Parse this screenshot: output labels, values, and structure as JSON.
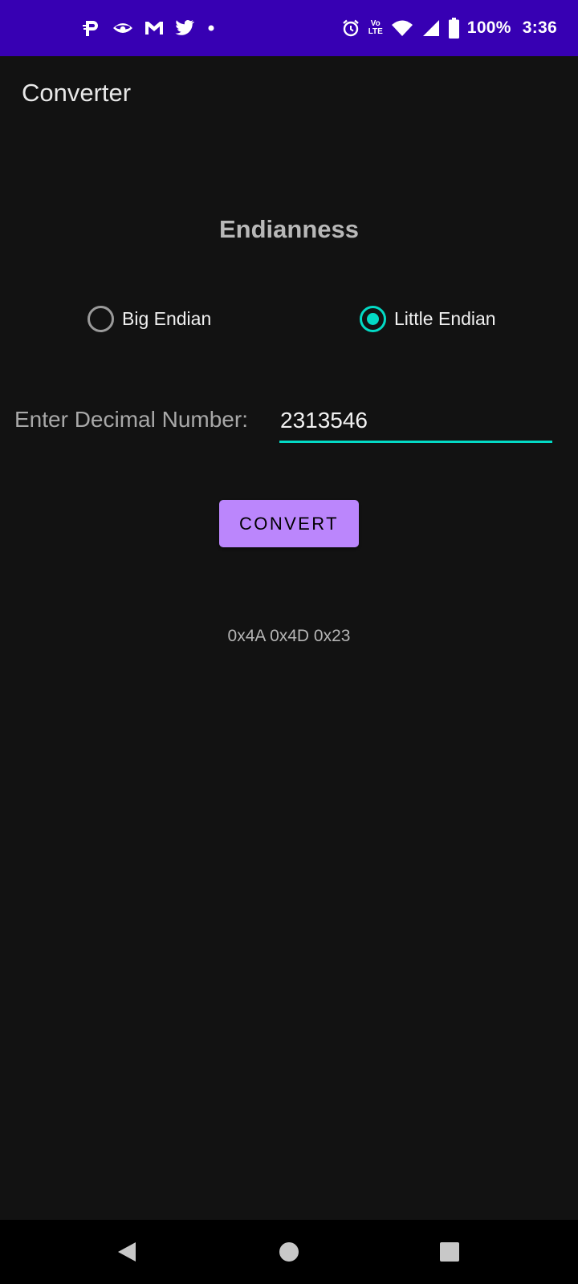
{
  "status_bar": {
    "battery": "100%",
    "time": "3:36",
    "lte_top": "Vo",
    "lte_bottom": "LTE",
    "background": "#3700b3",
    "left_icons": [
      "paytm-icon",
      "eye-icon",
      "gmail-icon",
      "twitter-icon",
      "dot-icon"
    ],
    "right_icons": [
      "alarm-icon",
      "volte-icon",
      "wifi-icon",
      "signal-icon",
      "battery-icon"
    ]
  },
  "app_bar": {
    "title": "Converter"
  },
  "main": {
    "section_title": "Endianness",
    "radios": [
      {
        "label": "Big Endian",
        "checked": false
      },
      {
        "label": "Little Endian",
        "checked": true
      }
    ],
    "input_label": "Enter Decimal Number:",
    "input_value": "2313546",
    "button_label": "CONVERT",
    "result": "0x4A 0x4D 0x23"
  },
  "colors": {
    "accent": "#03dac5",
    "button": "#bb86fc",
    "background": "#121212"
  },
  "nav_bar": {
    "icons": [
      "back-icon",
      "home-icon",
      "recents-icon"
    ]
  }
}
